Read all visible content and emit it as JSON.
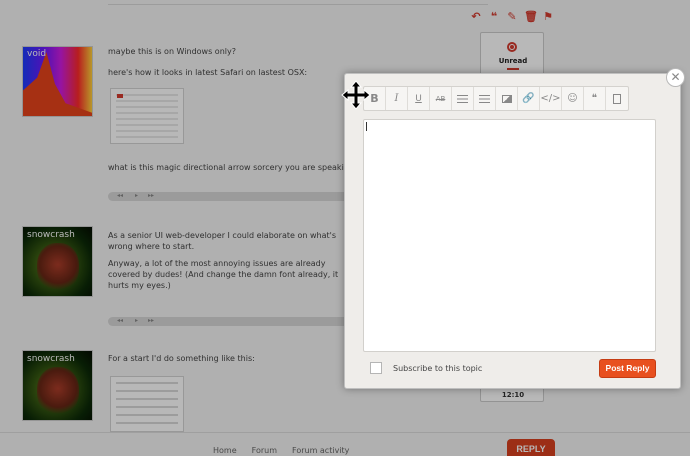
{
  "post_actions": [
    "↶",
    "❝",
    "✎",
    "🗑",
    "⚑"
  ],
  "posts": [
    {
      "author": "void",
      "paragraphs": [
        "maybe this is on Windows only?",
        "here's how it looks in latest Safari on lastest OSX:",
        "what is this magic directional arrow sorcery you are speaking abo"
      ]
    },
    {
      "author": "snowcrash",
      "paragraphs": [
        "As a senior UI web-developer I could elaborate on what's wrong where to start.",
        "Anyway, a lot of the most annoying issues are already covered by dudes! (And change the damn font already, it hurts my eyes.)"
      ]
    },
    {
      "author": "snowcrash",
      "paragraphs": [
        "For a start I'd do something like this:"
      ]
    }
  ],
  "audio_controls": [
    "◂◂",
    "▸",
    "▸▸"
  ],
  "sidebar": {
    "status": "Unread",
    "time": "12:10"
  },
  "footer": {
    "links": [
      "Home",
      "Forum",
      "Forum activity"
    ],
    "reply_label": "REPLY"
  },
  "composer": {
    "close_glyph": "✕",
    "toolbar": {
      "bold": "B",
      "italic": "I",
      "underline": "U",
      "strike": "AB",
      "link": "🔗",
      "code": "</>",
      "emoji": "☺",
      "quote": "❝"
    },
    "subscribe_label": "Subscribe to this topic",
    "post_reply_label": "Post Reply"
  }
}
